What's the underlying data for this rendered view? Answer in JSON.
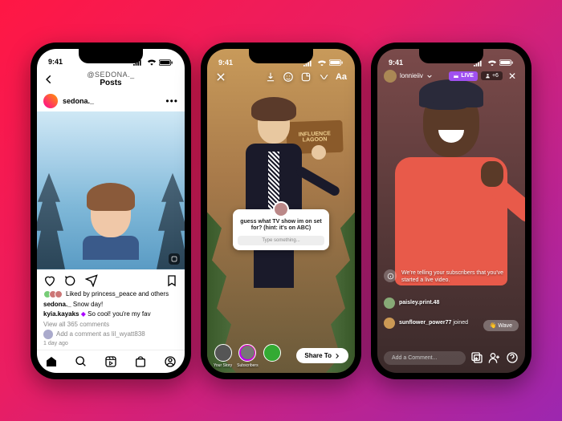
{
  "status": {
    "time": "9:41"
  },
  "phone1": {
    "header_user": "@SEDONA._",
    "header_title": "Posts",
    "username": "sedona._",
    "caption_user": "sedona._",
    "caption_text": "Snow day!",
    "comment_user": "kyia.kayaks",
    "comment_text": "So cool! you're my fav",
    "comment_badge": "◆",
    "likes_text": "Liked by princess_peace and others",
    "view_comments": "View all 365 comments",
    "add_comment": "Add a comment as lil_wyatt838",
    "timestamp": "1 day ago"
  },
  "phone2": {
    "sign": "INFLUENCE LAGOON",
    "question": "guess what TV show im on set for? (hint: it's on ABC)",
    "placeholder": "Type something...",
    "your_story": "Your Story",
    "subscribers": "Subscribers",
    "share": "Share To",
    "text_tool": "Aa"
  },
  "phone3": {
    "username": "lonnieiiv",
    "live": "LIVE",
    "viewers": "+6",
    "notice": "We're telling your subscribers that you've started a live video.",
    "comment1_user": "paisley.print.48",
    "comment1_text": "",
    "comment2_user": "sunflower_power77",
    "comment2_text": "joined",
    "wave": "👋 Wave",
    "add_comment": "Add a Comment..."
  }
}
